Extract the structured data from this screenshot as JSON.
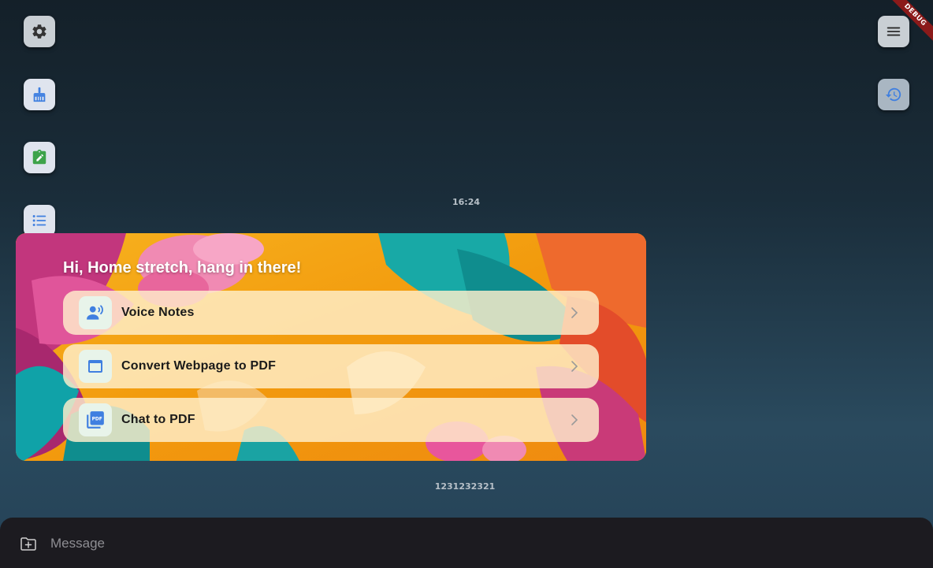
{
  "left_toolbar": [
    {
      "icon": "gear-icon",
      "color": "#3a3a3a"
    },
    {
      "icon": "broom-icon",
      "color": "#3f7fe0"
    },
    {
      "icon": "clipboard-edit-icon",
      "color": "#3da34a"
    },
    {
      "icon": "list-icon",
      "color": "#3f7fe0"
    }
  ],
  "right_toolbar": [
    {
      "icon": "hamburger-menu-icon",
      "color": "#2b2b2b"
    },
    {
      "icon": "history-icon",
      "color": "#3f7fe0"
    }
  ],
  "debug_banner": "DEBUG",
  "message": {
    "time": "16:24",
    "greeting": "Hi, Home stretch, hang in there!",
    "actions": [
      {
        "label": "Voice Notes",
        "icon": "voice-notes-icon"
      },
      {
        "label": "Convert Webpage to PDF",
        "icon": "web-window-icon"
      },
      {
        "label": "Chat to PDF",
        "icon": "pdf-icon"
      }
    ],
    "sender": "1231232321"
  },
  "composer": {
    "placeholder": "Message",
    "attach_icon": "attach-file-icon"
  },
  "colors": {
    "accent_blue": "#3f7fe0",
    "action_bg": "#ffefcc",
    "composer_bg": "#1c1b20"
  }
}
